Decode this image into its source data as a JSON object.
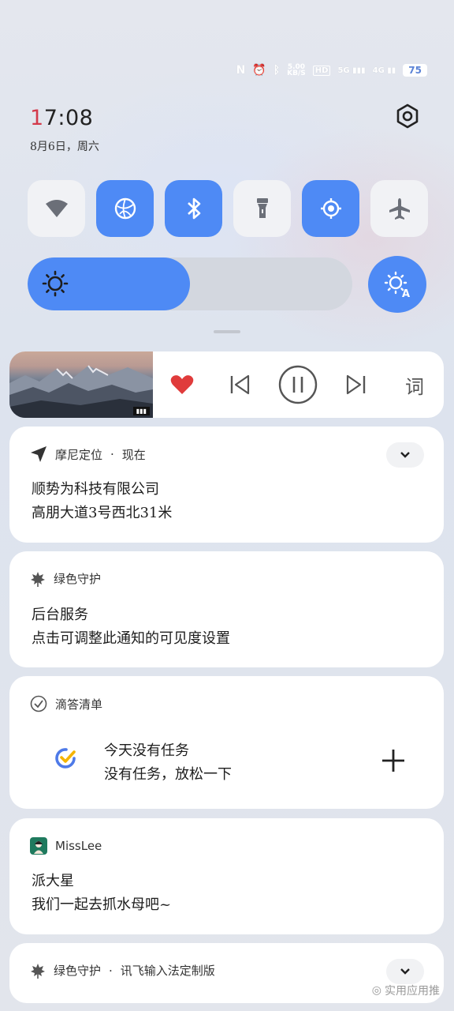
{
  "status_bar": {
    "nfc": "N",
    "network_speed_value": "5.00",
    "network_speed_unit": "KB/S",
    "hd_badge": "HD",
    "signal_1": "5G",
    "signal_2": "4G",
    "battery": "75"
  },
  "header": {
    "time_first": "1",
    "time_rest": "7:08",
    "date": "8月6日，周六"
  },
  "quick_toggles": [
    {
      "name": "wifi",
      "icon": "wifi-icon",
      "on": false
    },
    {
      "name": "network",
      "icon": "globe-icon",
      "on": true
    },
    {
      "name": "bluetooth",
      "icon": "bluetooth-icon",
      "on": true
    },
    {
      "name": "flashlight",
      "icon": "flashlight-icon",
      "on": false
    },
    {
      "name": "location",
      "icon": "location-icon",
      "on": true
    },
    {
      "name": "airplane",
      "icon": "airplane-icon",
      "on": false
    }
  ],
  "brightness": {
    "level": 0.5,
    "auto_icon": "auto-brightness-icon"
  },
  "media": {
    "art_logo": "▮▮▮",
    "controls": [
      "heart-icon",
      "previous-icon",
      "pause-icon",
      "next-icon"
    ],
    "lyrics_label": "词"
  },
  "notifications": [
    {
      "app": "摩尼定位",
      "separator": "·",
      "time": "现在",
      "title": "顺势为科技有限公司",
      "text": "高朋大道3号西北31米"
    },
    {
      "app": "绿色守护",
      "title": "后台服务",
      "text": "点击可调整此通知的可见度设置"
    },
    {
      "app": "滴答清单",
      "title": "今天没有任务",
      "text": "没有任务，放松一下"
    },
    {
      "app": "MissLee",
      "title": "派大星",
      "text": "我们一起去抓水母吧~"
    },
    {
      "app": "绿色守护",
      "separator": "·",
      "extra": "讯飞输入法定制版"
    }
  ],
  "watermark": "实用应用推",
  "colors": {
    "accent_blue": "#4e8af5",
    "time_red": "#d33a4b",
    "heart_red": "#e03b3b"
  }
}
